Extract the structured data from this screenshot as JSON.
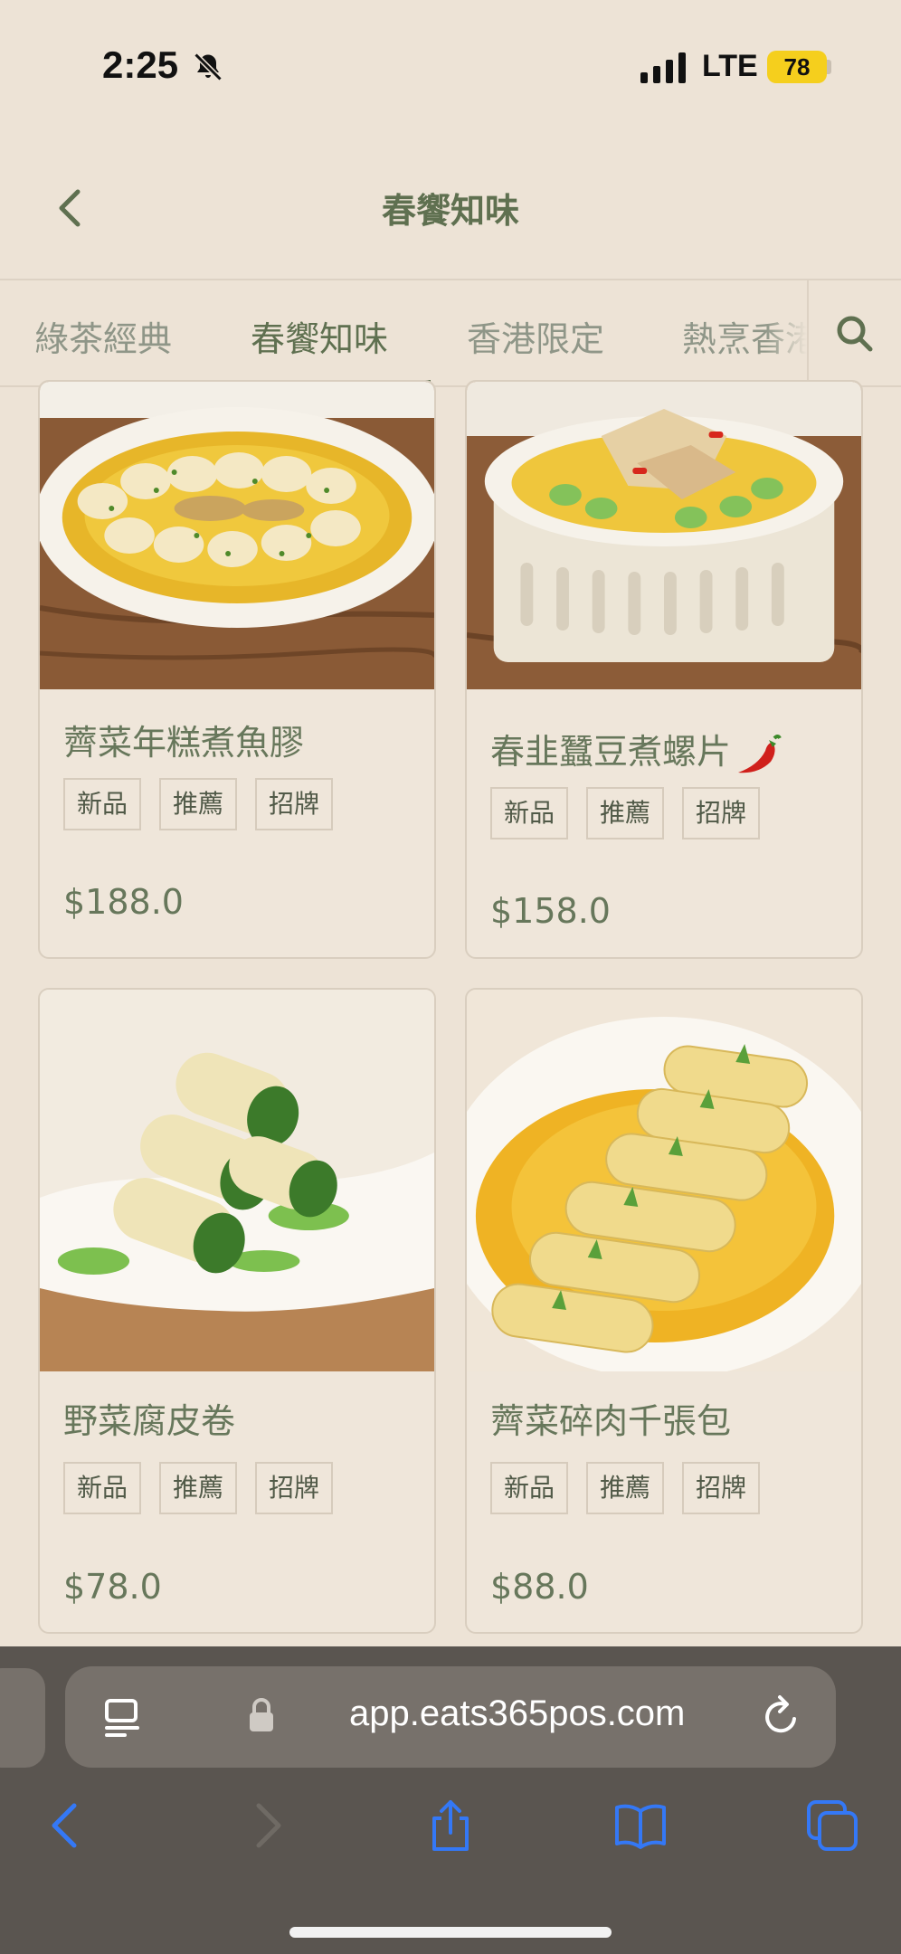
{
  "status_bar": {
    "time": "2:25",
    "network": "LTE",
    "battery": "78"
  },
  "header": {
    "title": "春饗知味"
  },
  "tabs": [
    {
      "label": "綠茶經典",
      "active": false
    },
    {
      "label": "春饗知味",
      "active": true
    },
    {
      "label": "香港限定",
      "active": false
    },
    {
      "label": "熱烹香港",
      "active": false
    }
  ],
  "products": [
    {
      "name": "薺菜年糕煮魚膠",
      "tags": [
        "新品",
        "推薦",
        "招牌"
      ],
      "price": "$188.0",
      "spicy": false,
      "image": "rice-cake-fish-maw-dish"
    },
    {
      "name": "春韭蠶豆煮螺片",
      "tags": [
        "新品",
        "推薦",
        "招牌"
      ],
      "price": "$158.0",
      "spicy": true,
      "image": "broad-bean-conch-dish"
    },
    {
      "name": "野菜腐皮卷",
      "tags": [
        "新品",
        "推薦",
        "招牌"
      ],
      "price": "$78.0",
      "spicy": false,
      "image": "tofu-skin-roll-dish"
    },
    {
      "name": "薺菜碎肉千張包",
      "tags": [
        "新品",
        "推薦",
        "招牌"
      ],
      "price": "$88.0",
      "spicy": false,
      "image": "bean-curd-sheet-roll-dish"
    }
  ],
  "browser": {
    "url": "app.eats365pos.com"
  },
  "colors": {
    "background": "#ede3d6",
    "accent": "#5f7050",
    "browser_bar": "#5a5550",
    "safari_blue": "#3478f6"
  }
}
